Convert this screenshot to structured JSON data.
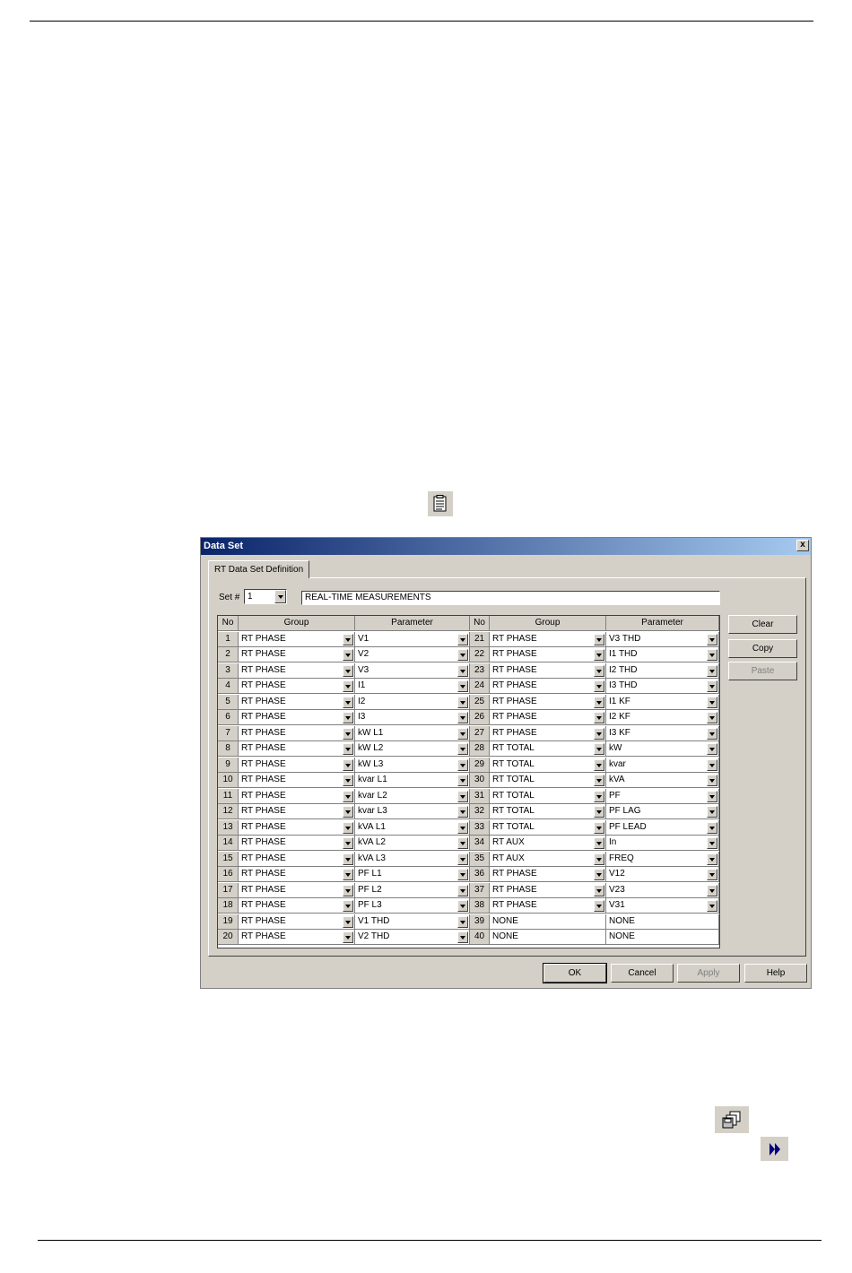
{
  "dialog": {
    "title": "Data Set",
    "close_glyph": "x",
    "tab_label": "RT Data Set Definition",
    "set_label": "Set #",
    "set_value": "1",
    "set_name": "REAL-TIME MEASUREMENTS",
    "side_buttons": {
      "clear": "Clear",
      "copy": "Copy",
      "paste": "Paste"
    },
    "footer_buttons": {
      "ok": "OK",
      "cancel": "Cancel",
      "apply": "Apply",
      "help": "Help"
    }
  },
  "table": {
    "headers": [
      "No",
      "Group",
      "Parameter",
      "No",
      "Group",
      "Parameter"
    ],
    "left_rows": [
      {
        "no": "1",
        "group": "RT PHASE",
        "param": "V1"
      },
      {
        "no": "2",
        "group": "RT PHASE",
        "param": "V2"
      },
      {
        "no": "3",
        "group": "RT PHASE",
        "param": "V3"
      },
      {
        "no": "4",
        "group": "RT PHASE",
        "param": "I1"
      },
      {
        "no": "5",
        "group": "RT PHASE",
        "param": "I2"
      },
      {
        "no": "6",
        "group": "RT PHASE",
        "param": "I3"
      },
      {
        "no": "7",
        "group": "RT PHASE",
        "param": "kW L1"
      },
      {
        "no": "8",
        "group": "RT PHASE",
        "param": "kW L2"
      },
      {
        "no": "9",
        "group": "RT PHASE",
        "param": "kW L3"
      },
      {
        "no": "10",
        "group": "RT PHASE",
        "param": "kvar L1"
      },
      {
        "no": "11",
        "group": "RT PHASE",
        "param": "kvar L2"
      },
      {
        "no": "12",
        "group": "RT PHASE",
        "param": "kvar L3"
      },
      {
        "no": "13",
        "group": "RT PHASE",
        "param": "kVA L1"
      },
      {
        "no": "14",
        "group": "RT PHASE",
        "param": "kVA L2"
      },
      {
        "no": "15",
        "group": "RT PHASE",
        "param": "kVA L3"
      },
      {
        "no": "16",
        "group": "RT PHASE",
        "param": "PF L1"
      },
      {
        "no": "17",
        "group": "RT PHASE",
        "param": "PF L2"
      },
      {
        "no": "18",
        "group": "RT PHASE",
        "param": "PF L3"
      },
      {
        "no": "19",
        "group": "RT PHASE",
        "param": "V1 THD"
      },
      {
        "no": "20",
        "group": "RT PHASE",
        "param": "V2 THD"
      }
    ],
    "right_rows": [
      {
        "no": "21",
        "group": "RT PHASE",
        "param": "V3 THD"
      },
      {
        "no": "22",
        "group": "RT PHASE",
        "param": "I1 THD"
      },
      {
        "no": "23",
        "group": "RT PHASE",
        "param": "I2 THD"
      },
      {
        "no": "24",
        "group": "RT PHASE",
        "param": "I3 THD"
      },
      {
        "no": "25",
        "group": "RT PHASE",
        "param": "I1 KF"
      },
      {
        "no": "26",
        "group": "RT PHASE",
        "param": "I2 KF"
      },
      {
        "no": "27",
        "group": "RT PHASE",
        "param": "I3 KF"
      },
      {
        "no": "28",
        "group": "RT TOTAL",
        "param": "kW"
      },
      {
        "no": "29",
        "group": "RT TOTAL",
        "param": "kvar"
      },
      {
        "no": "30",
        "group": "RT TOTAL",
        "param": "kVA"
      },
      {
        "no": "31",
        "group": "RT TOTAL",
        "param": "PF"
      },
      {
        "no": "32",
        "group": "RT TOTAL",
        "param": "PF LAG"
      },
      {
        "no": "33",
        "group": "RT TOTAL",
        "param": "PF LEAD"
      },
      {
        "no": "34",
        "group": "RT AUX",
        "param": "In"
      },
      {
        "no": "35",
        "group": "RT AUX",
        "param": "FREQ"
      },
      {
        "no": "36",
        "group": "RT PHASE",
        "param": "V12"
      },
      {
        "no": "37",
        "group": "RT PHASE",
        "param": "V23"
      },
      {
        "no": "38",
        "group": "RT PHASE",
        "param": "V31"
      },
      {
        "no": "39",
        "group": "NONE",
        "param": "NONE"
      },
      {
        "no": "40",
        "group": "NONE",
        "param": "NONE"
      }
    ]
  },
  "icons": [
    "document-list-icon",
    "disk-stack-icon",
    "fast-forward-icon"
  ]
}
